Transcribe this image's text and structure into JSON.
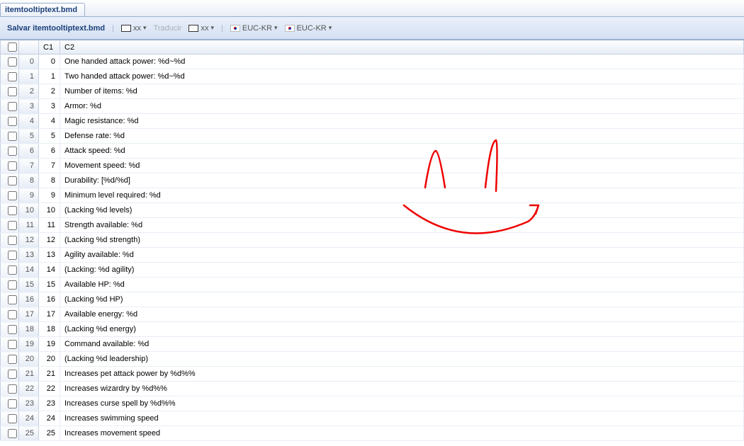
{
  "tab": {
    "title": "itemtooltiptext.bmd"
  },
  "toolbar": {
    "save_label": "Salvar itemtooltiptext.bmd",
    "lang1_label": "xx",
    "translate_label": "Traducir",
    "lang2_label": "xx",
    "enc1_label": "EUC-KR",
    "enc2_label": "EUC-KR"
  },
  "columns": {
    "chk": "",
    "rownum": "",
    "c1": "C1",
    "c2": "C2"
  },
  "rows": [
    {
      "c1": 0,
      "c2": "One handed attack power: %d~%d"
    },
    {
      "c1": 1,
      "c2": "Two handed attack power: %d~%d"
    },
    {
      "c1": 2,
      "c2": "Number of items: %d"
    },
    {
      "c1": 3,
      "c2": "Armor: %d"
    },
    {
      "c1": 4,
      "c2": "Magic resistance: %d"
    },
    {
      "c1": 5,
      "c2": "Defense rate: %d"
    },
    {
      "c1": 6,
      "c2": "Attack speed: %d"
    },
    {
      "c1": 7,
      "c2": "Movement speed: %d"
    },
    {
      "c1": 8,
      "c2": "Durability: [%d/%d]"
    },
    {
      "c1": 9,
      "c2": "Minimum level required: %d"
    },
    {
      "c1": 10,
      "c2": "(Lacking %d levels)"
    },
    {
      "c1": 11,
      "c2": "Strength available: %d"
    },
    {
      "c1": 12,
      "c2": "(Lacking %d strength)"
    },
    {
      "c1": 13,
      "c2": "Agility available: %d"
    },
    {
      "c1": 14,
      "c2": "(Lacking: %d agility)"
    },
    {
      "c1": 15,
      "c2": "Available HP: %d"
    },
    {
      "c1": 16,
      "c2": "(Lacking %d HP)"
    },
    {
      "c1": 17,
      "c2": "Available energy: %d"
    },
    {
      "c1": 18,
      "c2": "(Lacking %d energy)"
    },
    {
      "c1": 19,
      "c2": "Command available: %d"
    },
    {
      "c1": 20,
      "c2": "(Lacking %d leadership)"
    },
    {
      "c1": 21,
      "c2": "Increases pet attack power by %d%%"
    },
    {
      "c1": 22,
      "c2": "Increases wizardry by %d%%"
    },
    {
      "c1": 23,
      "c2": "Increases curse spell by %d%%"
    },
    {
      "c1": 24,
      "c2": "Increases swimming speed"
    },
    {
      "c1": 25,
      "c2": "Increases movement speed"
    }
  ]
}
